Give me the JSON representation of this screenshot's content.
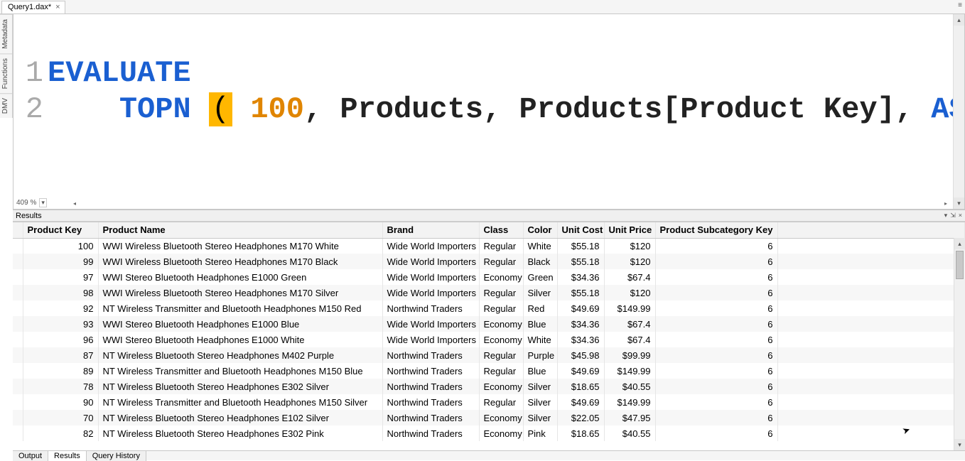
{
  "tab": {
    "title": "Query1.dax*",
    "close": "×"
  },
  "topright_icon": "≡",
  "side_tabs": [
    "Metadata",
    "Functions",
    "DMV"
  ],
  "editor": {
    "line1_num": "1",
    "line2_num": "2",
    "kw_evaluate": "EVALUATE",
    "kw_topn": "TOPN",
    "paren_open": "(",
    "arg_n": "100",
    "comma1": ",",
    "arg_table": "Products",
    "comma2": ",",
    "arg_col": "Products[Product Key]",
    "comma3": ",",
    "kw_asc": "ASC",
    "paren_close": ")",
    "zoom": "409 %",
    "zoom_drop": "▾",
    "sc_left": "◂",
    "sc_right": "▸",
    "sc_up": "▴",
    "sc_dn": "▾"
  },
  "results": {
    "title": "Results",
    "icon_dd": "▾",
    "icon_pin": "⇲",
    "icon_close": "×"
  },
  "columns": {
    "key": "Product Key",
    "name": "Product Name",
    "brand": "Brand",
    "class": "Class",
    "color": "Color",
    "cost": "Unit Cost",
    "price": "Unit Price",
    "sub": "Product Subcategory Key"
  },
  "rows": [
    {
      "k": "100",
      "n": "WWI Wireless Bluetooth Stereo Headphones M170 White",
      "b": "Wide World Importers",
      "cl": "Regular",
      "co": "White",
      "uc": "$55.18",
      "up": "$120",
      "s": "6"
    },
    {
      "k": "99",
      "n": "WWI Wireless Bluetooth Stereo Headphones M170 Black",
      "b": "Wide World Importers",
      "cl": "Regular",
      "co": "Black",
      "uc": "$55.18",
      "up": "$120",
      "s": "6"
    },
    {
      "k": "97",
      "n": "WWI Stereo Bluetooth Headphones E1000 Green",
      "b": "Wide World Importers",
      "cl": "Economy",
      "co": "Green",
      "uc": "$34.36",
      "up": "$67.4",
      "s": "6"
    },
    {
      "k": "98",
      "n": "WWI Wireless Bluetooth Stereo Headphones M170 Silver",
      "b": "Wide World Importers",
      "cl": "Regular",
      "co": "Silver",
      "uc": "$55.18",
      "up": "$120",
      "s": "6"
    },
    {
      "k": "92",
      "n": "NT Wireless Transmitter and Bluetooth Headphones M150 Red",
      "b": "Northwind Traders",
      "cl": "Regular",
      "co": "Red",
      "uc": "$49.69",
      "up": "$149.99",
      "s": "6"
    },
    {
      "k": "93",
      "n": "WWI Stereo Bluetooth Headphones E1000 Blue",
      "b": "Wide World Importers",
      "cl": "Economy",
      "co": "Blue",
      "uc": "$34.36",
      "up": "$67.4",
      "s": "6"
    },
    {
      "k": "96",
      "n": "WWI Stereo Bluetooth Headphones E1000 White",
      "b": "Wide World Importers",
      "cl": "Economy",
      "co": "White",
      "uc": "$34.36",
      "up": "$67.4",
      "s": "6"
    },
    {
      "k": "87",
      "n": "NT Wireless Bluetooth Stereo Headphones M402 Purple",
      "b": "Northwind Traders",
      "cl": "Regular",
      "co": "Purple",
      "uc": "$45.98",
      "up": "$99.99",
      "s": "6"
    },
    {
      "k": "89",
      "n": "NT Wireless Transmitter and Bluetooth Headphones M150 Blue",
      "b": "Northwind Traders",
      "cl": "Regular",
      "co": "Blue",
      "uc": "$49.69",
      "up": "$149.99",
      "s": "6"
    },
    {
      "k": "78",
      "n": "NT Wireless Bluetooth Stereo Headphones E302 Silver",
      "b": "Northwind Traders",
      "cl": "Economy",
      "co": "Silver",
      "uc": "$18.65",
      "up": "$40.55",
      "s": "6"
    },
    {
      "k": "90",
      "n": "NT Wireless Transmitter and Bluetooth Headphones M150 Silver",
      "b": "Northwind Traders",
      "cl": "Regular",
      "co": "Silver",
      "uc": "$49.69",
      "up": "$149.99",
      "s": "6"
    },
    {
      "k": "70",
      "n": "NT Wireless Bluetooth Stereo Headphones E102 Silver",
      "b": "Northwind Traders",
      "cl": "Economy",
      "co": "Silver",
      "uc": "$22.05",
      "up": "$47.95",
      "s": "6"
    },
    {
      "k": "82",
      "n": "NT Wireless Bluetooth Stereo Headphones E302 Pink",
      "b": "Northwind Traders",
      "cl": "Economy",
      "co": "Pink",
      "uc": "$18.65",
      "up": "$40.55",
      "s": "6"
    }
  ],
  "bottom_tabs": {
    "output": "Output",
    "results": "Results",
    "history": "Query History"
  }
}
